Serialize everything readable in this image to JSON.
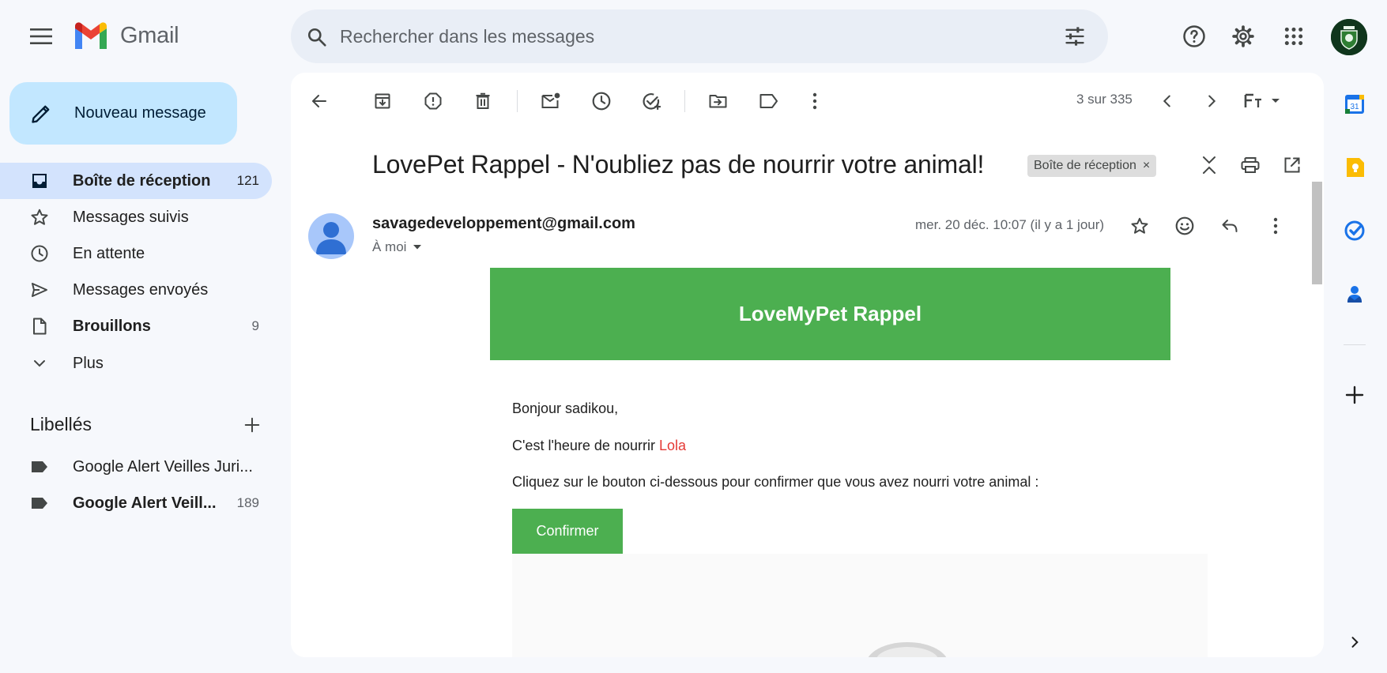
{
  "app": {
    "name": "Gmail"
  },
  "search": {
    "placeholder": "Rechercher dans les messages"
  },
  "compose": {
    "label": "Nouveau message"
  },
  "sidebar": {
    "items": [
      {
        "label": "Boîte de réception",
        "count": "121",
        "bold": true,
        "active": true
      },
      {
        "label": "Messages suivis",
        "count": ""
      },
      {
        "label": "En attente",
        "count": ""
      },
      {
        "label": "Messages envoyés",
        "count": ""
      },
      {
        "label": "Brouillons",
        "count": "9",
        "bold": true
      },
      {
        "label": "Plus",
        "count": ""
      }
    ],
    "labels_title": "Libellés",
    "labels": [
      {
        "label": "Google Alert Veilles Juri...",
        "count": ""
      },
      {
        "label": "Google Alert Veill...",
        "count": "189",
        "bold": true
      }
    ]
  },
  "toolbar": {
    "pager": "3 sur 335"
  },
  "email": {
    "subject": "LovePet Rappel - N'oubliez pas de nourrir votre animal!",
    "chip": "Boîte de réception",
    "chip_close": "×",
    "sender": "savagedeveloppement@gmail.com",
    "recipient": "À moi",
    "date": "mer. 20 déc. 10:07 (il y a 1 jour)",
    "body": {
      "banner_title": "LoveMyPet Rappel",
      "greeting": "Bonjour sadikou,",
      "reminder_prefix": "C'est l'heure de nourrir ",
      "pet_name": "Lola",
      "instruction": "Cliquez sur le bouton ci-dessous pour confirmer que vous avez nourri votre animal :",
      "confirm_label": "Confirmer"
    }
  },
  "colors": {
    "background": "#f6f8fc",
    "compose": "#c2e7ff",
    "active_nav": "#d3e3fd",
    "search": "#e9eef6",
    "banner_green": "#4caf50",
    "pet_name_red": "#e53935"
  },
  "icons": {
    "topbar": [
      "menu-icon",
      "gmail-logo",
      "search-icon",
      "filter-options-icon",
      "help-icon",
      "settings-icon",
      "apps-icon",
      "account-avatar"
    ],
    "toolbar": [
      "back-arrow-icon",
      "archive-icon",
      "report-spam-icon",
      "delete-icon",
      "mark-unread-icon",
      "snooze-icon",
      "add-task-icon",
      "move-to-icon",
      "label-icon",
      "more-vert-icon",
      "chevron-left-icon",
      "chevron-right-icon",
      "input-tools-icon"
    ],
    "rail": [
      "calendar-icon",
      "keep-icon",
      "tasks-icon",
      "contacts-icon",
      "add-icon",
      "expand-icon"
    ]
  }
}
